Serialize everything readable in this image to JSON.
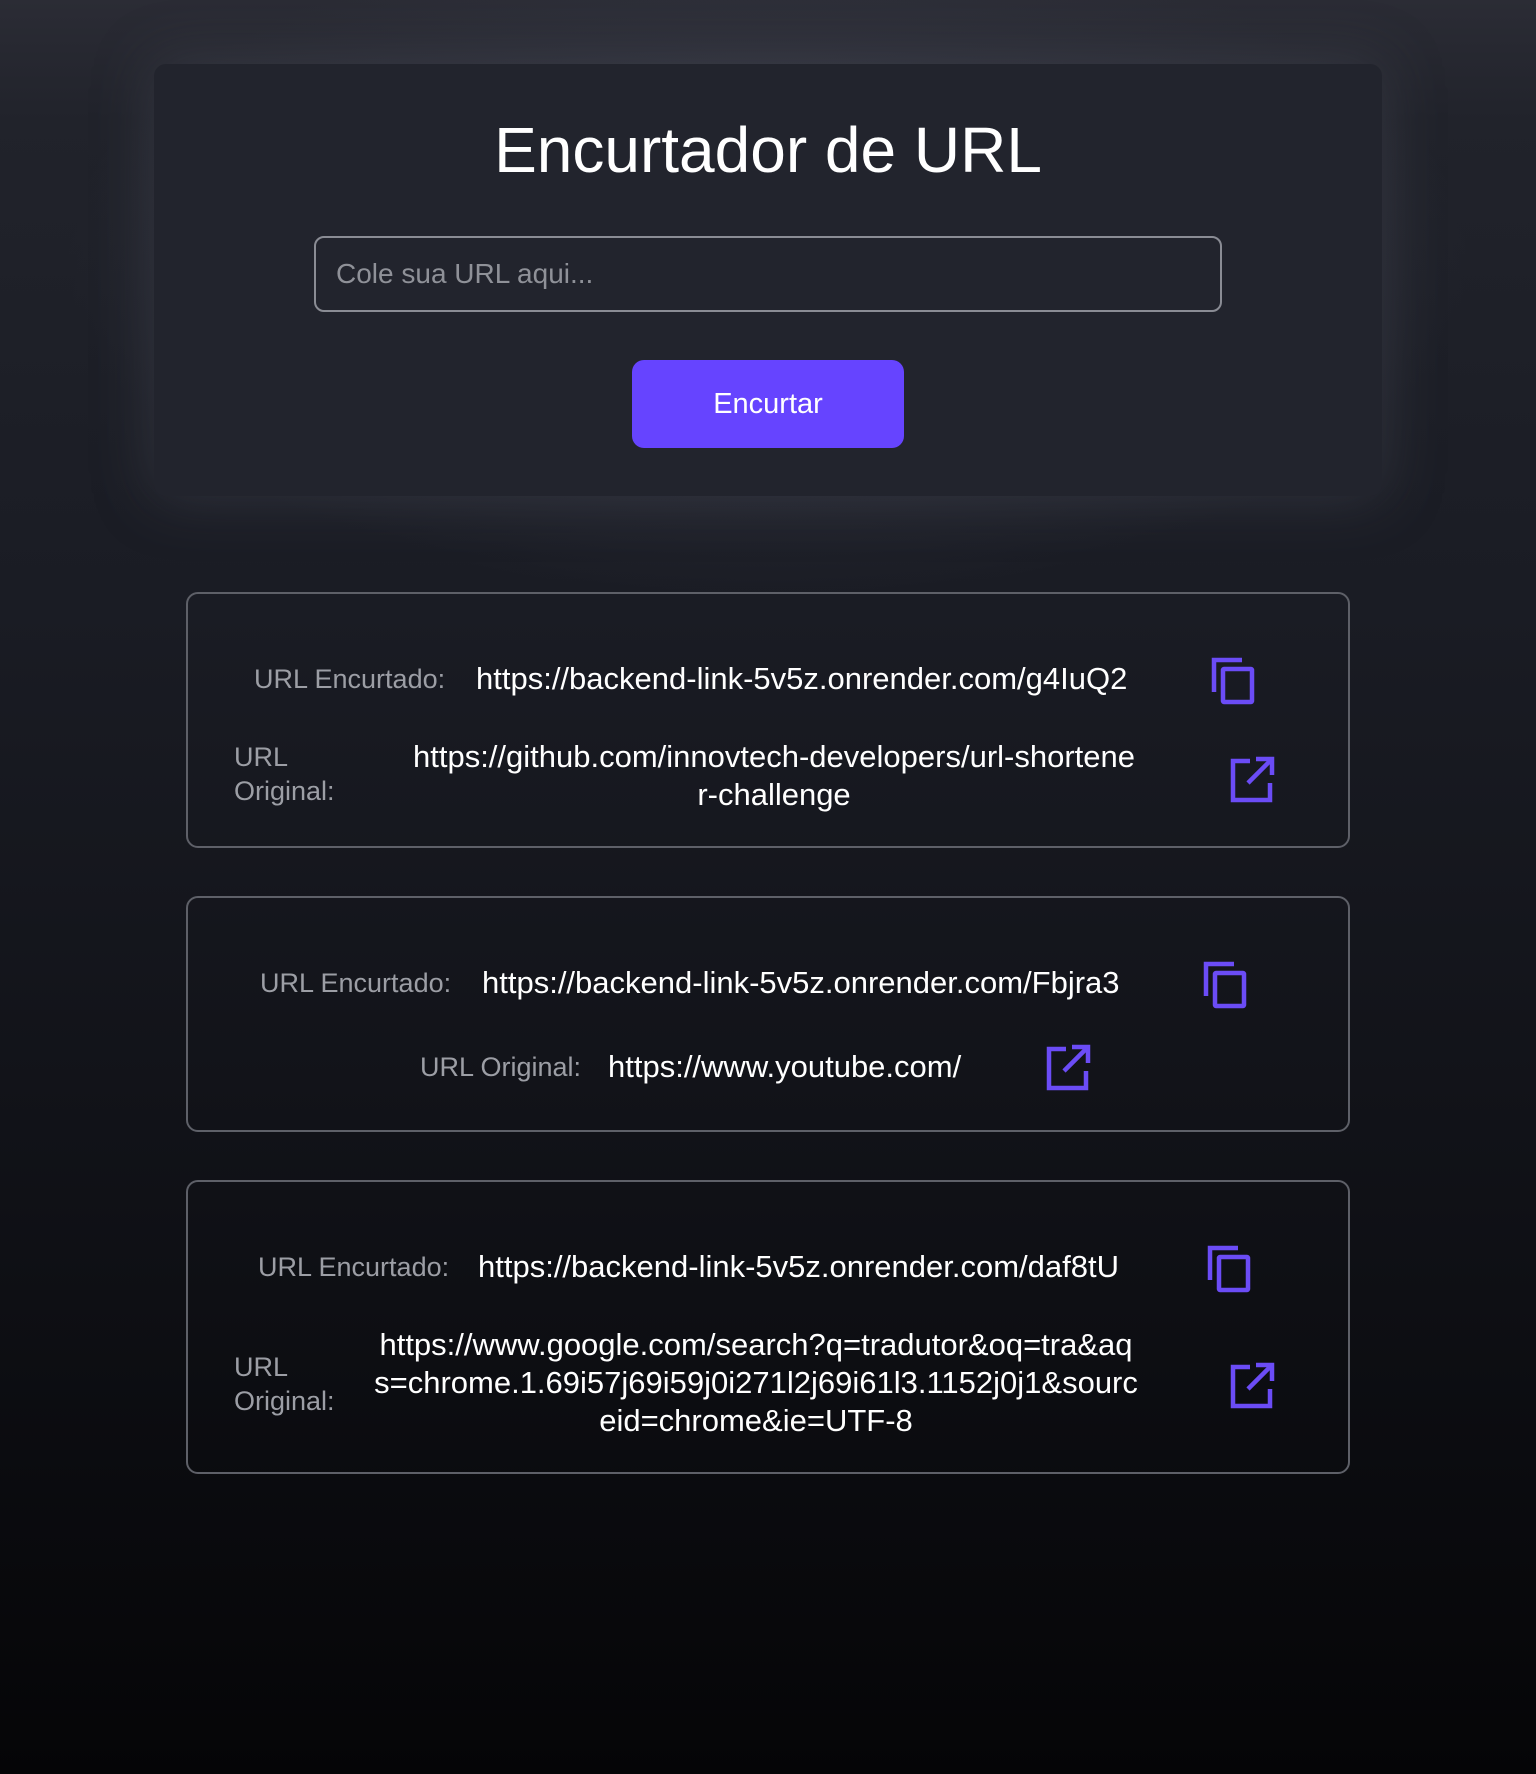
{
  "app": {
    "title": "Encurtador de URL"
  },
  "form": {
    "placeholder": "Cole sua URL aqui...",
    "value": "",
    "button_label": "Encurtar"
  },
  "links": [
    {
      "short_label": "URL Encurtado:",
      "short_url": "https://backend-link-5v5z.onrender.com/g4IuQ2",
      "original_label_line1": "URL",
      "original_label_line2": "Original:",
      "original_url_line1": "https://github.com/innovtech-developers/url-shortene",
      "original_url_line2": "r-challenge"
    },
    {
      "short_label": "URL Encurtado:",
      "short_url": "https://backend-link-5v5z.onrender.com/Fbjra3",
      "original_label": "URL Original:",
      "original_url": "https://www.youtube.com/"
    },
    {
      "short_label": "URL Encurtado:",
      "short_url": "https://backend-link-5v5z.onrender.com/daf8tU",
      "original_label_line1": "URL",
      "original_label_line2": "Original:",
      "original_url_line1": "https://www.google.com/search?q=tradutor&oq=tra&aq",
      "original_url_line2": "s=chrome.1.69i57j69i59j0i271l2j69i61l3.1152j0j1&sourc",
      "original_url_line3": "eid=chrome&ie=UTF-8"
    }
  ],
  "icons": {
    "copy": "copy-icon",
    "open": "external-link-icon"
  },
  "colors": {
    "accent": "#6644ff",
    "icon": "#6b4cf6",
    "card_bg": "#22242d",
    "border": "#5e6068",
    "label": "#9c9ea5"
  }
}
